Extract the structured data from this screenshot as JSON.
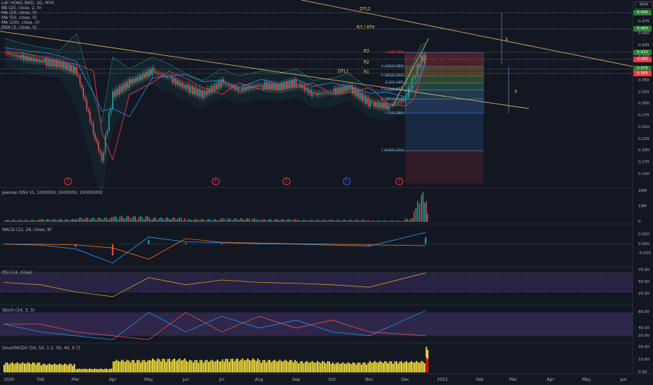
{
  "header": {
    "symbol_line": "LAY HONG BHD, 1D, MYX",
    "overlays": [
      "BB (20, close, 2, 0)",
      "MA (20, close, 0)",
      "MA (50, close, 0)",
      "MA (200, close, 0)",
      "EMA (5, close, 0)"
    ],
    "currency_button": "MYR"
  },
  "annotations": {
    "dtl1": "DTL1",
    "dtl2": "DTL2",
    "r1": "R1",
    "r2": "R2",
    "r3": "R3",
    "r3_ath": "R3 / ATH",
    "x1": "X",
    "x2": "X"
  },
  "fib_labels": [
    "0(0.410)",
    "0.236(0.380)",
    "0.382(0.360)",
    "0.5(0.345)",
    "0.618(0.330)",
    "0.786(0.310)",
    "1(0.280)",
    "1.618(0.200)"
  ],
  "fib_values": [
    0.41,
    0.38,
    0.36,
    0.345,
    0.33,
    0.31,
    0.28,
    0.2
  ],
  "price_tags": [
    {
      "value": 0.495,
      "text": "0.495",
      "color": "#2e7d32"
    },
    {
      "value": 0.46,
      "text": "0.460",
      "color": "#2e7d32"
    },
    {
      "value": 0.41,
      "text": "0.410",
      "color": "#2e7d32"
    },
    {
      "value": 0.395,
      "text": "0.395",
      "color": "#f23645"
    },
    {
      "value": 0.375,
      "text": "0.375",
      "color": "#2e7d32"
    },
    {
      "value": 0.365,
      "text": "0.365",
      "color": "#f23645"
    }
  ],
  "event_markers": [
    {
      "date": "2020-02-24",
      "letter": "E",
      "kind": "earnings"
    },
    {
      "date": "2020-06-26",
      "letter": "E",
      "kind": "earnings"
    },
    {
      "date": "2020-08-24",
      "letter": "E",
      "kind": "earnings"
    },
    {
      "date": "2020-10-13",
      "letter": "D",
      "kind": "dividend"
    },
    {
      "date": "2020-11-26",
      "letter": "E",
      "kind": "earnings"
    }
  ],
  "chart_data": [
    {
      "type": "candlestick",
      "title": "LAY HONG BHD, 1D, MYX",
      "xlabel": "",
      "ylabel": "",
      "x_ticks": [
        "2020",
        "Feb",
        "Mar",
        "Apr",
        "May",
        "Jun",
        "Jul",
        "Aug",
        "Sep",
        "Oct",
        "Nov",
        "Dec",
        "2021",
        "Feb",
        "Mar",
        "Apr",
        "May",
        "Jun"
      ],
      "ylim": [
        0.13,
        0.51
      ],
      "y_ticks": [
        0.15,
        0.175,
        0.2,
        0.225,
        0.25,
        0.275,
        0.3,
        0.325,
        0.35,
        0.375,
        0.4,
        0.425,
        0.45,
        0.475
      ],
      "grid": false,
      "series": [
        {
          "name": "Close",
          "x": [
            "2020-01-02",
            "2020-01-15",
            "2020-02-03",
            "2020-02-17",
            "2020-03-02",
            "2020-03-16",
            "2020-03-23",
            "2020-04-01",
            "2020-04-15",
            "2020-05-04",
            "2020-05-18",
            "2020-06-01",
            "2020-06-15",
            "2020-07-01",
            "2020-07-15",
            "2020-08-03",
            "2020-08-17",
            "2020-09-01",
            "2020-09-15",
            "2020-10-01",
            "2020-10-15",
            "2020-11-02",
            "2020-11-16",
            "2020-12-01",
            "2020-12-08",
            "2020-12-14",
            "2020-12-18"
          ],
          "values": [
            0.41,
            0.4,
            0.39,
            0.385,
            0.37,
            0.24,
            0.18,
            0.32,
            0.345,
            0.37,
            0.355,
            0.335,
            0.32,
            0.345,
            0.33,
            0.34,
            0.335,
            0.345,
            0.32,
            0.325,
            0.335,
            0.3,
            0.295,
            0.31,
            0.36,
            0.395,
            0.4
          ]
        }
      ]
    },
    {
      "type": "bar",
      "title": "Jeeman DNV (0, 1000000, 5000000, 20000000)",
      "ylim": [
        0,
        21000000
      ],
      "y_ticks": [
        "0",
        "10M",
        "20M"
      ],
      "x": [
        "2020-01",
        "2020-02",
        "2020-03",
        "2020-04",
        "2020-05",
        "2020-06",
        "2020-07",
        "2020-08",
        "2020-09",
        "2020-10",
        "2020-11",
        "2020-12-01",
        "2020-12-08",
        "2020-12-14",
        "2020-12-18"
      ],
      "values": [
        1500000,
        2000000,
        3000000,
        4000000,
        3000000,
        2000000,
        2500000,
        2000000,
        1500000,
        1500000,
        1000000,
        2500000,
        14000000,
        20000000,
        16000000
      ]
    },
    {
      "type": "line",
      "title": "MACD (12, 26, close, 9)",
      "ylim": [
        -0.045,
        0.04
      ],
      "y_ticks": [
        "0.020",
        "0.000",
        "-0.020"
      ],
      "x": [
        "2020-01",
        "2020-02",
        "2020-03",
        "2020-04",
        "2020-05",
        "2020-06",
        "2020-07",
        "2020-08",
        "2020-09",
        "2020-10",
        "2020-11",
        "2020-12-18"
      ],
      "series": [
        {
          "name": "MACD",
          "values": [
            0.0,
            -0.002,
            -0.01,
            -0.04,
            0.015,
            0.005,
            0.003,
            0.001,
            0.0,
            -0.002,
            -0.004,
            0.025
          ]
        }
      ]
    },
    {
      "type": "line",
      "title": "RSI (14, close)",
      "ylim": [
        5,
        80
      ],
      "y_ticks": [
        "75.00",
        "50.00",
        "25.00"
      ],
      "x": [
        "2020-01",
        "2020-02",
        "2020-03",
        "2020-04",
        "2020-05",
        "2020-06",
        "2020-07",
        "2020-08",
        "2020-09",
        "2020-10",
        "2020-11",
        "2020-12-18"
      ],
      "series": [
        {
          "name": "RSI",
          "values": [
            50,
            45,
            30,
            20,
            60,
            45,
            55,
            50,
            48,
            45,
            40,
            70
          ]
        }
      ]
    },
    {
      "type": "line",
      "title": "Stoch (14, 3, 3)",
      "ylim": [
        5,
        95
      ],
      "y_ticks": [
        "80.00",
        "40.00",
        "20.00"
      ],
      "x": [
        "2020-01",
        "2020-02",
        "2020-03",
        "2020-04",
        "2020-05",
        "2020-06",
        "2020-07",
        "2020-08",
        "2020-09",
        "2020-10",
        "2020-11",
        "2020-12-18"
      ],
      "series": [
        {
          "name": "%K",
          "values": [
            50,
            30,
            20,
            10,
            80,
            30,
            70,
            40,
            60,
            30,
            20,
            85
          ]
        }
      ]
    },
    {
      "type": "bar",
      "title": "SmartMCDX (50, 50, 1.5, 30, 40, 0.7)",
      "ylim": [
        0,
        22
      ],
      "y_ticks": [
        "20.00",
        "10.00",
        "0.00"
      ],
      "x": [
        "2020-01",
        "2020-02",
        "2020-03",
        "2020-04",
        "2020-05",
        "2020-06",
        "2020-07",
        "2020-08",
        "2020-09",
        "2020-10",
        "2020-11",
        "2020-12-18"
      ],
      "values": [
        8,
        7,
        3,
        10,
        11,
        10,
        11,
        10,
        9,
        8,
        9,
        20
      ]
    }
  ]
}
